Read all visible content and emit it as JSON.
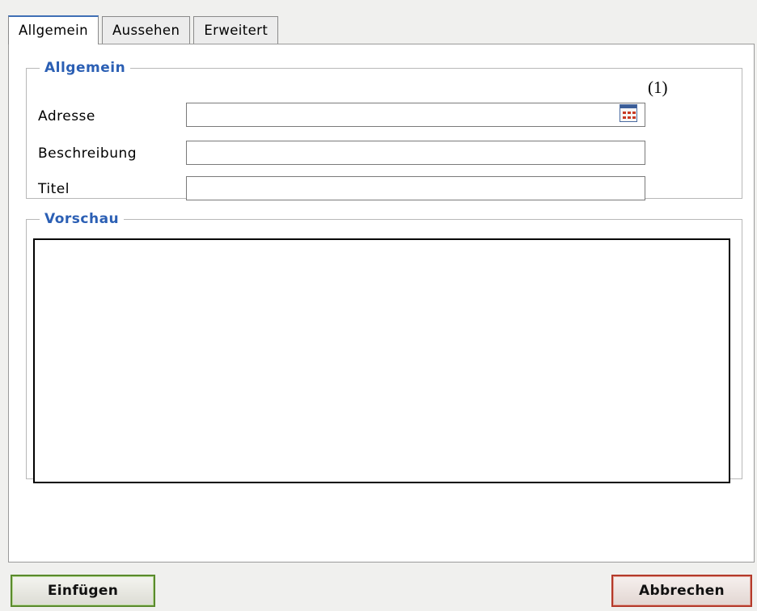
{
  "tabs": [
    {
      "label": "Allgemein",
      "active": true
    },
    {
      "label": "Aussehen",
      "active": false
    },
    {
      "label": "Erweitert",
      "active": false
    }
  ],
  "general": {
    "legend": "Allgemein",
    "address_label": "Adresse",
    "address_value": "",
    "description_label": "Beschreibung",
    "description_value": "",
    "title_label": "Titel",
    "title_value": "",
    "browse_icon": "calendar-browse-icon"
  },
  "annotation": "(1)",
  "preview": {
    "legend": "Vorschau"
  },
  "buttons": {
    "insert_label": "Einfügen",
    "cancel_label": "Abbrechen"
  },
  "colors": {
    "legend_text": "#2b5fb4",
    "insert_border": "#5a8a2c",
    "cancel_border": "#b43a2a"
  }
}
